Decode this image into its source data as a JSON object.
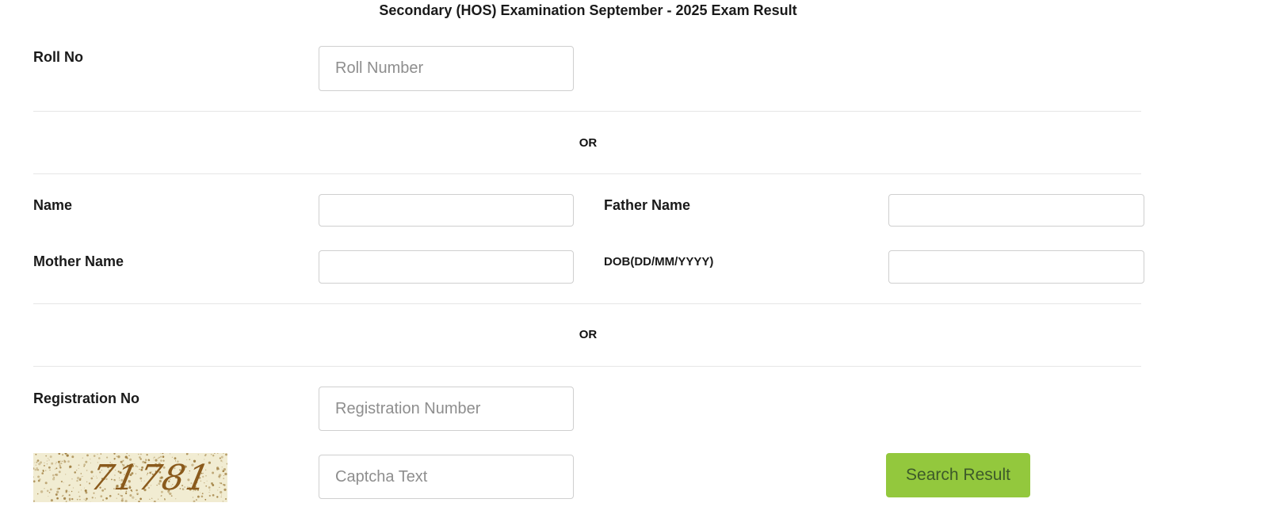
{
  "page": {
    "title": "Secondary (HOS) Examination September - 2025 Exam Result"
  },
  "form": {
    "roll": {
      "label": "Roll No",
      "placeholder": "Roll Number"
    },
    "or1": "OR",
    "name": {
      "label": "Name",
      "placeholder": ""
    },
    "father_name": {
      "label": "Father Name",
      "placeholder": ""
    },
    "mother_name": {
      "label": "Mother Name",
      "placeholder": ""
    },
    "dob": {
      "label": "DOB(DD/MM/YYYY)",
      "placeholder": ""
    },
    "or2": "OR",
    "registration": {
      "label": "Registration No",
      "placeholder": "Registration Number"
    },
    "captcha": {
      "image_text": "71781",
      "placeholder": "Captcha Text"
    },
    "submit_label": "Search Result"
  },
  "colors": {
    "button_bg": "#93c83d",
    "button_text": "#3d5a2a",
    "captcha_bg": "#f1ecd2",
    "captcha_text": "#8a5a1c"
  }
}
